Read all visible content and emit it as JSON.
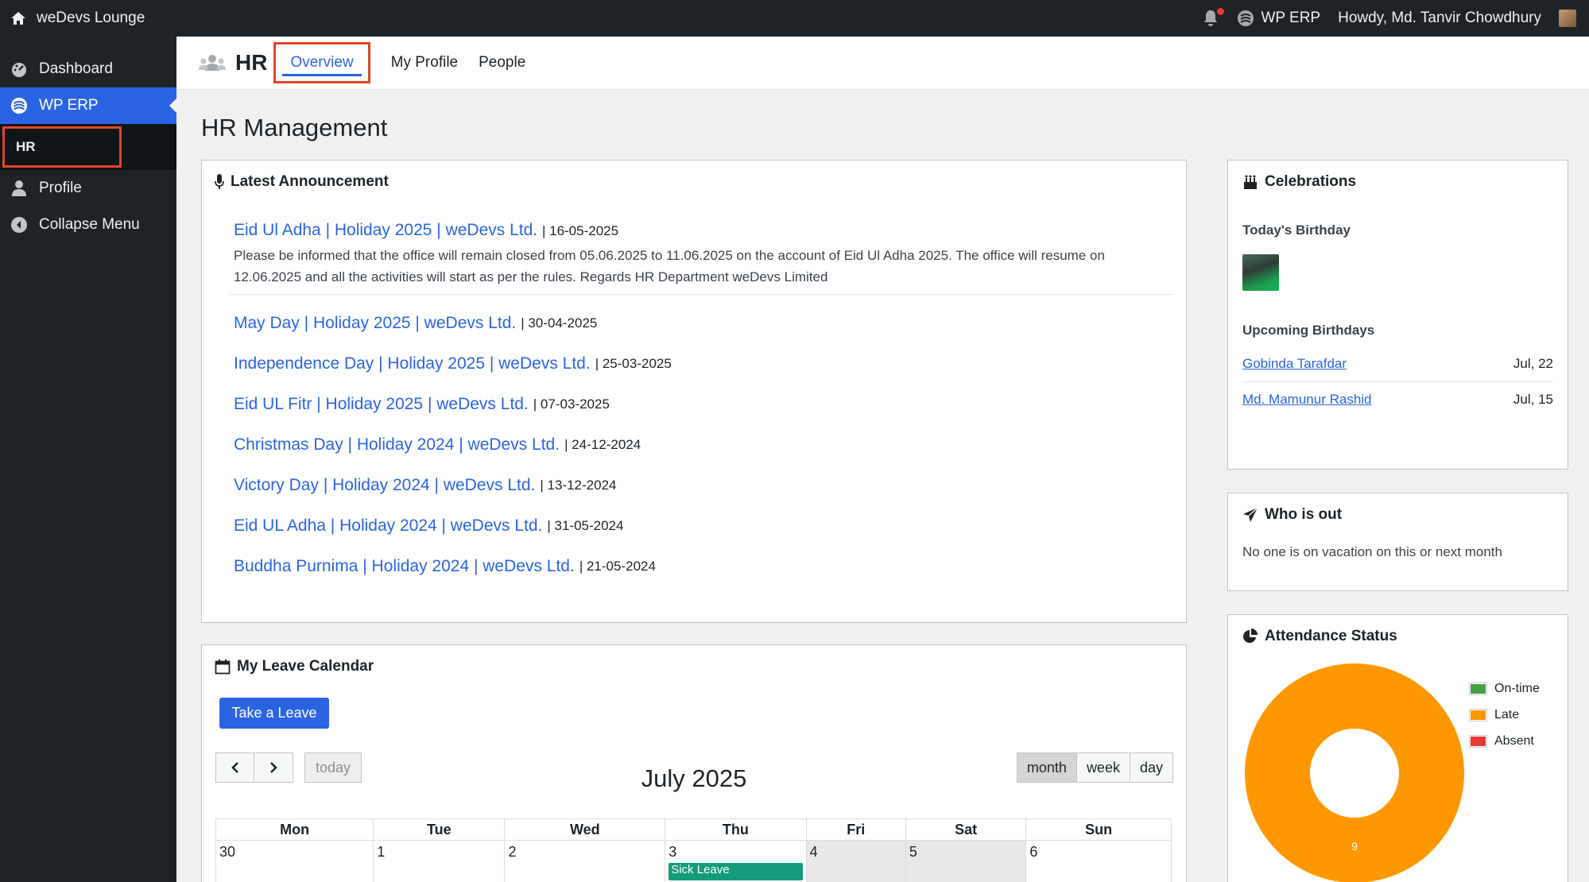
{
  "adminbar": {
    "site_name": "weDevs Lounge",
    "erp_label": "WP ERP",
    "greeting": "Howdy, Md. Tanvir Chowdhury"
  },
  "sidebar": {
    "items": [
      {
        "label": "Dashboard"
      },
      {
        "label": "WP ERP"
      },
      {
        "label": "HR"
      },
      {
        "label": "Profile"
      },
      {
        "label": "Collapse Menu"
      }
    ]
  },
  "header": {
    "title": "HR",
    "tabs": [
      "Overview",
      "My Profile",
      "People"
    ]
  },
  "page": {
    "title": "HR Management"
  },
  "announcements": {
    "title": "Latest Announcement",
    "first": {
      "title": "Eid Ul Adha | Holiday 2025 | weDevs Ltd.",
      "date": "| 16-05-2025",
      "body": "Please be informed that the office will remain closed from 05.06.2025 to 11.06.2025 on the account of Eid Ul Adha 2025. The office will resume on 12.06.2025 and all the activities will start as per the rules. Regards HR Department weDevs Limited"
    },
    "items": [
      {
        "title": "May Day | Holiday 2025 | weDevs Ltd.",
        "date": "| 30-04-2025"
      },
      {
        "title": "Independence Day | Holiday 2025 | weDevs Ltd.",
        "date": "| 25-03-2025"
      },
      {
        "title": "Eid UL Fitr | Holiday 2025 | weDevs Ltd.",
        "date": "| 07-03-2025"
      },
      {
        "title": "Christmas Day | Holiday 2024 | weDevs Ltd.",
        "date": "| 24-12-2024"
      },
      {
        "title": "Victory Day | Holiday 2024 | weDevs Ltd.",
        "date": "| 13-12-2024"
      },
      {
        "title": "Eid UL Adha | Holiday 2024 | weDevs Ltd.",
        "date": "| 31-05-2024"
      },
      {
        "title": "Buddha Purnima | Holiday 2024 | weDevs Ltd.",
        "date": "| 21-05-2024"
      }
    ]
  },
  "leave_calendar": {
    "title": "My Leave Calendar",
    "take_leave": "Take a Leave",
    "today": "today",
    "views": [
      "month",
      "week",
      "day"
    ],
    "month_title": "July 2025",
    "days": [
      "Mon",
      "Tue",
      "Wed",
      "Thu",
      "Fri",
      "Sat",
      "Sun"
    ],
    "dates": [
      "30",
      "1",
      "2",
      "3",
      "4",
      "5",
      "6"
    ],
    "event": "Sick Leave"
  },
  "celebrations": {
    "title": "Celebrations",
    "today_label": "Today's Birthday",
    "upcoming_label": "Upcoming Birthdays",
    "upcoming": [
      {
        "name": "Gobinda Tarafdar",
        "date": "Jul, 22"
      },
      {
        "name": "Md. Mamunur Rashid",
        "date": "Jul, 15"
      }
    ]
  },
  "who_is_out": {
    "title": "Who is out",
    "message": "No one is on vacation on this or next month"
  },
  "attendance": {
    "title": "Attendance Status",
    "legend": [
      {
        "label": "On-time",
        "color": "#43a047"
      },
      {
        "label": "Late",
        "color": "#ff9800"
      },
      {
        "label": "Absent",
        "color": "#e53935"
      }
    ],
    "center_value": "9"
  },
  "chart_data": {
    "type": "pie",
    "categories": [
      "On-time",
      "Late",
      "Absent"
    ],
    "values": [
      0,
      9,
      0
    ],
    "title": "Attendance Status",
    "legend": "right"
  }
}
